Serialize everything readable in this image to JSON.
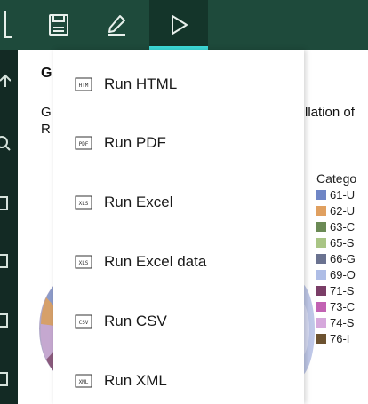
{
  "toolbar": {
    "buttons": [
      {
        "name": "save",
        "icon": "save-icon"
      },
      {
        "name": "edit",
        "icon": "pencil-icon"
      },
      {
        "name": "run",
        "icon": "play-icon",
        "active": true
      }
    ],
    "accent_color": "#3ddbd9",
    "bg_color": "#1e4a3b"
  },
  "run_menu": {
    "items": [
      {
        "label": "Run HTML",
        "icon": "html-file-icon",
        "icon_text": "HTM"
      },
      {
        "label": "Run PDF",
        "icon": "pdf-file-icon",
        "icon_text": "PDF"
      },
      {
        "label": "Run Excel",
        "icon": "excel-file-icon",
        "icon_text": "XLS"
      },
      {
        "label": "Run Excel data",
        "icon": "excel-data-file-icon",
        "icon_text": "XLS"
      },
      {
        "label": "Run CSV",
        "icon": "csv-file-icon",
        "icon_text": "CSV"
      },
      {
        "label": "Run XML",
        "icon": "xml-file-icon",
        "icon_text": "XML"
      }
    ]
  },
  "report": {
    "title_fragment": "G",
    "line1_left": "G",
    "line1_right": "llation of",
    "line2_left": "R"
  },
  "legend": {
    "title": "Catego",
    "items": [
      {
        "label": "61-U",
        "color": "#6f86c6"
      },
      {
        "label": "62-U",
        "color": "#e0a060"
      },
      {
        "label": "63-C",
        "color": "#6b8a55"
      },
      {
        "label": "65-S",
        "color": "#a9c585"
      },
      {
        "label": "66-G",
        "color": "#6a7290"
      },
      {
        "label": "69-O",
        "color": "#aebde6"
      },
      {
        "label": "71-S",
        "color": "#7a3d67"
      },
      {
        "label": "73-C",
        "color": "#c262b3"
      },
      {
        "label": "74-S",
        "color": "#d6a8dc"
      },
      {
        "label": "76-I",
        "color": "#6c5230"
      }
    ]
  }
}
